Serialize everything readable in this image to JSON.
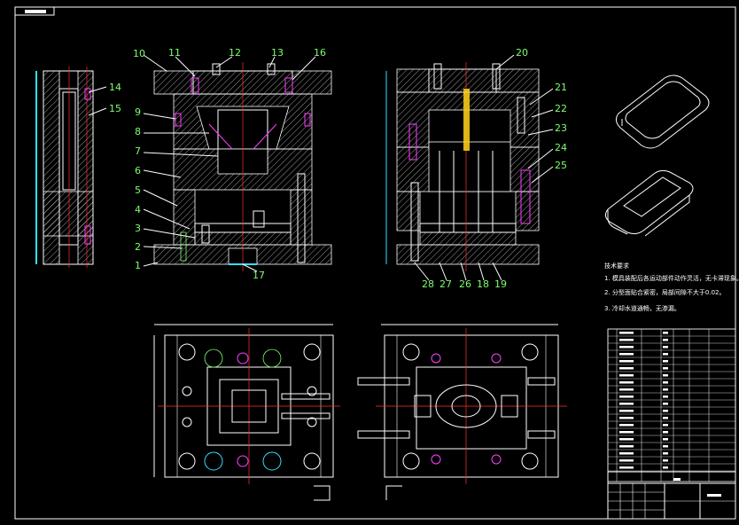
{
  "title_tab": "",
  "part_labels": {
    "left_side": [
      "10",
      "9",
      "8",
      "7",
      "6",
      "5",
      "4",
      "3",
      "2",
      "1"
    ],
    "top": [
      "11",
      "12",
      "13",
      "16"
    ],
    "bottom_mid": "17",
    "side_view": [
      "14",
      "15"
    ],
    "right_top": "20",
    "right_side": [
      "21",
      "22",
      "23",
      "24",
      "25"
    ],
    "right_bottom": [
      "28",
      "27",
      "26",
      "18",
      "19"
    ]
  },
  "notes_title": "技术要求",
  "notes": [
    "1. 模具装配后各运动部件动作灵活，无卡滞现象。",
    "2. 分型面贴合紧密，局部间隙不大于0.02。",
    "3. 冷却水道通畅，无渗漏。"
  ],
  "bom_rows": 20,
  "colors": {
    "background": "#000000",
    "line": "#ffffff",
    "label": "#7dff6e",
    "centerline": "#ff3030",
    "accent_cyan": "#31e0ff",
    "accent_magenta": "#ff40ff",
    "accent_yellow": "#ffd21a"
  }
}
